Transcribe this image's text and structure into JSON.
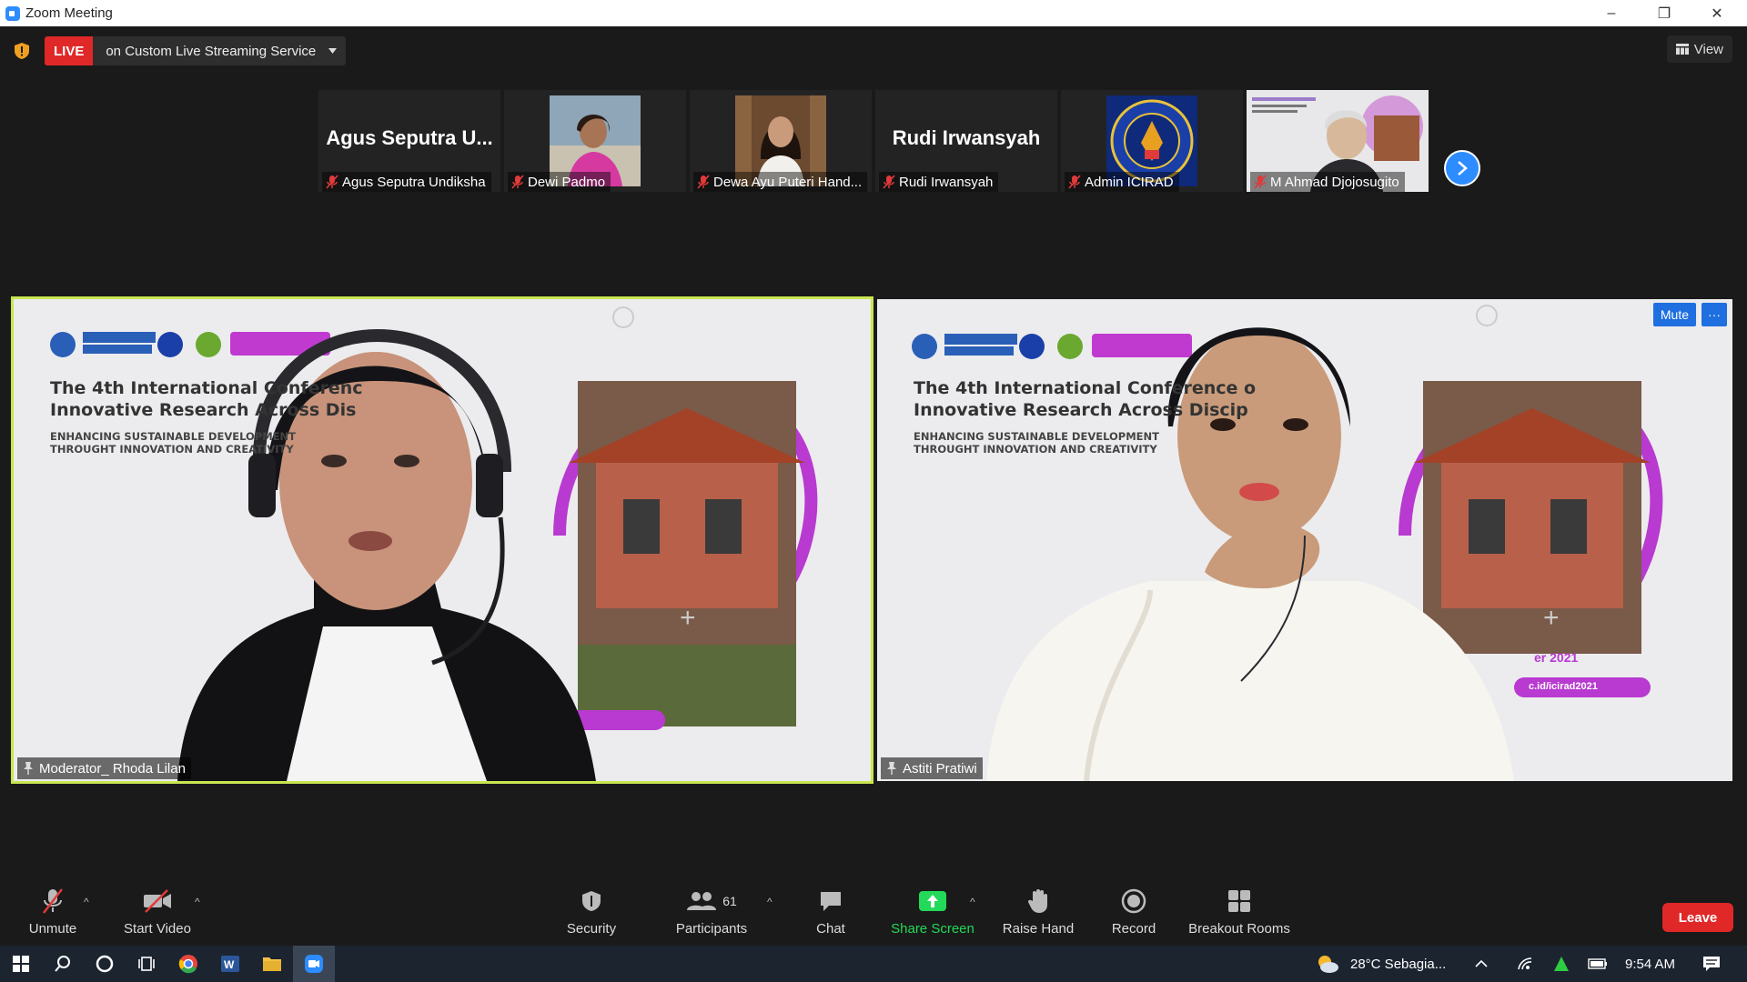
{
  "window": {
    "title": "Zoom Meeting",
    "controls": [
      "–",
      "❐",
      "✕"
    ]
  },
  "live": {
    "badge": "LIVE",
    "service": "on Custom Live Streaming Service",
    "view_label": "View"
  },
  "thumbnails": [
    {
      "big_name": "Agus Seputra U...",
      "label": "Agus Seputra Undiksha",
      "kind": "name"
    },
    {
      "big_name": "",
      "label": "Dewi Padmo",
      "kind": "photo"
    },
    {
      "big_name": "",
      "label": "Dewa Ayu Puteri Hand...",
      "kind": "photo"
    },
    {
      "big_name": "Rudi Irwansyah",
      "label": "Rudi Irwansyah",
      "kind": "name"
    },
    {
      "big_name": "",
      "label": "Admin ICIRAD",
      "kind": "logo"
    },
    {
      "big_name": "",
      "label": "M Ahmad Djojosugito",
      "kind": "video"
    }
  ],
  "tiles": {
    "left": {
      "name": "Moderator_ Rhoda Lilan",
      "conf_line1": "The 4th International Conferenc",
      "conf_line2": "Innovative Research Across Dis",
      "conf_sub1": "ENHANCING SUSTAINABLE DEVELOPMENT",
      "conf_sub2": "THROUGHT INNOVATION AND CREATIVITY"
    },
    "right": {
      "name": "Astiti Pratiwi",
      "conf_line1": "The 4th International Conference o",
      "conf_line2": "Innovative Research Across Discip",
      "conf_sub1": "ENHANCING SUSTAINABLE DEVELOPMENT",
      "conf_sub2": "THROUGHT INNOVATION AND CREATIVITY",
      "date_text": "er 2021",
      "url_text": "c.id/icirad2021",
      "mute_label": "Mute",
      "more_label": "···"
    }
  },
  "toolbar": {
    "unmute": "Unmute",
    "start_video": "Start Video",
    "security": "Security",
    "participants": "Participants",
    "participants_count": "61",
    "chat": "Chat",
    "share_screen": "Share Screen",
    "raise_hand": "Raise Hand",
    "record": "Record",
    "breakout_rooms": "Breakout Rooms",
    "leave": "Leave"
  },
  "taskbar": {
    "weather": "28°C  Sebagia...",
    "time": "9:54 AM"
  },
  "colors": {
    "live_red": "#e02828",
    "zoom_blue": "#2d8cff",
    "active_speaker": "#c8e650",
    "share_green": "#23d959"
  }
}
